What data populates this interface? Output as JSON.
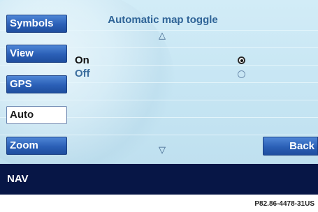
{
  "sidebar": {
    "items": [
      {
        "label": "Symbols"
      },
      {
        "label": "View"
      },
      {
        "label": "GPS"
      },
      {
        "label": "Auto"
      },
      {
        "label": "Zoom"
      }
    ]
  },
  "menu": {
    "title": "Automatic map toggle",
    "scroll_up_glyph": "△",
    "scroll_down_glyph": "▽",
    "options": [
      {
        "label": "On",
        "selected": true
      },
      {
        "label": "Off",
        "selected": false
      }
    ]
  },
  "back_button": {
    "label": "Back"
  },
  "status_bar": {
    "text": "NAV"
  },
  "figure_id": "P82.86-4478-31US",
  "colors": {
    "button_blue": "#2a5fb6",
    "screen_bg": "#c6e5f3",
    "status_bar": "#071646",
    "title_text": "#2f6497",
    "inactive_option": "#3c6e9e"
  }
}
